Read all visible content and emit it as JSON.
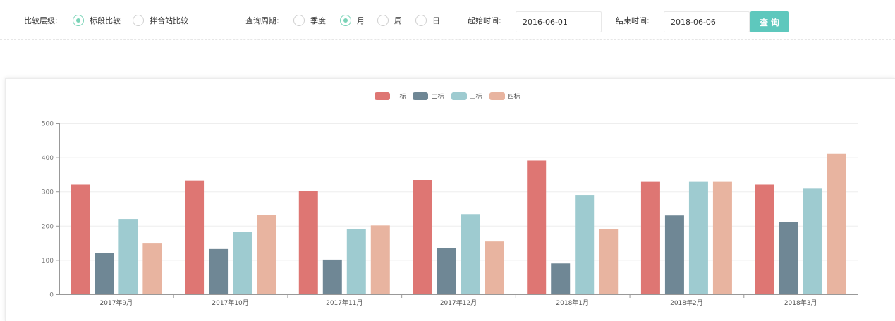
{
  "filters": {
    "level_label": "比较层级:",
    "level_options": [
      {
        "label": "标段比较",
        "checked": true
      },
      {
        "label": "拌合站比较",
        "checked": false
      }
    ],
    "period_label": "查询周期:",
    "period_options": [
      {
        "label": "季度",
        "checked": false
      },
      {
        "label": "月",
        "checked": true
      },
      {
        "label": "周",
        "checked": false
      },
      {
        "label": "日",
        "checked": false
      }
    ],
    "start_label": "起始时间:",
    "start_value": "2016-06-01",
    "end_label": "结束时间:",
    "end_value": "2018-06-06",
    "query_button": "查询"
  },
  "colors": {
    "accent": "#5ec8bd",
    "radio_checked": "#7ad3b7"
  },
  "chart_data": {
    "type": "bar",
    "categories": [
      "2017年9月",
      "2017年10月",
      "2017年11月",
      "2017年12月",
      "2018年1月",
      "2018年2月",
      "2018年3月"
    ],
    "series": [
      {
        "name": "一标",
        "color": "#de7673",
        "values": [
          320,
          332,
          301,
          334,
          390,
          330,
          320
        ]
      },
      {
        "name": "二标",
        "color": "#6f8795",
        "values": [
          120,
          132,
          101,
          134,
          90,
          230,
          210
        ]
      },
      {
        "name": "三标",
        "color": "#9ecbd0",
        "values": [
          220,
          182,
          191,
          234,
          290,
          330,
          310
        ]
      },
      {
        "name": "四标",
        "color": "#e8b4a0",
        "values": [
          150,
          232,
          201,
          154,
          190,
          330,
          410
        ]
      }
    ],
    "ylim": [
      0,
      500
    ],
    "yticks": [
      0,
      100,
      200,
      300,
      400,
      500
    ],
    "grid": true,
    "legend_position": "top-center"
  }
}
